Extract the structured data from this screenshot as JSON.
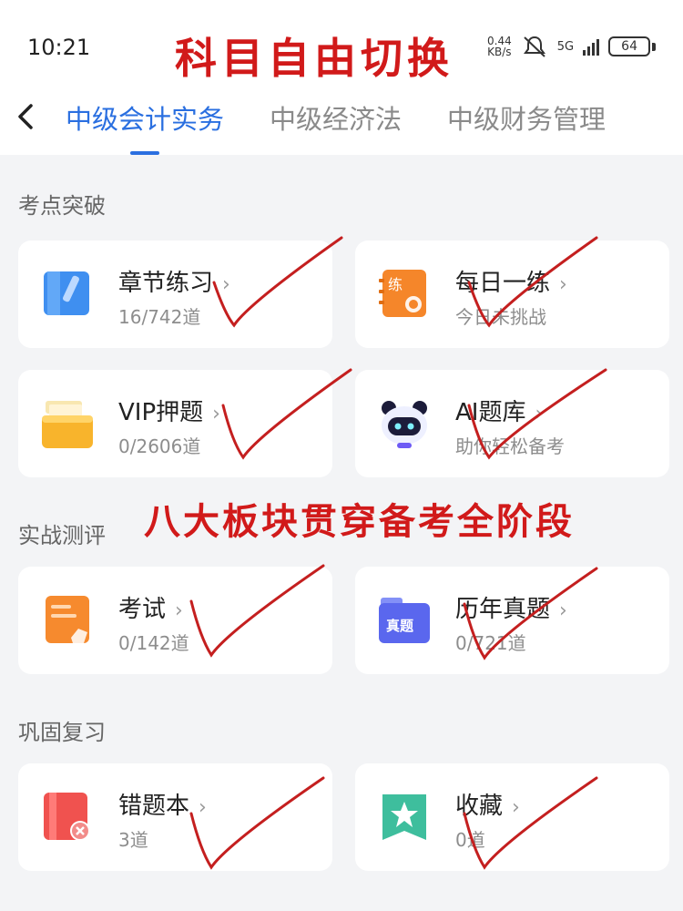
{
  "status": {
    "time": "10:21",
    "net_speed_value": "0.44",
    "net_speed_unit": "KB/s",
    "network": "5G",
    "battery": "64"
  },
  "overlay": {
    "top_title": "科目自由切换",
    "middle_banner": "八大板块贯穿备考全阶段"
  },
  "tabs": [
    {
      "label": "中级会计实务",
      "active": true
    },
    {
      "label": "中级经济法",
      "active": false
    },
    {
      "label": "中级财务管理",
      "active": false
    }
  ],
  "sections": [
    {
      "title": "考点突破",
      "cards": [
        {
          "title": "章节练习",
          "subtitle": "16/742道",
          "icon": "book-icon"
        },
        {
          "title": "每日一练",
          "subtitle": "今日未挑战",
          "icon": "calendar-practice-icon"
        },
        {
          "title": "VIP押题",
          "subtitle": "0/2606道",
          "icon": "folder-icon"
        },
        {
          "title": "AI题库",
          "subtitle": "助你轻松备考",
          "icon": "panda-robot-icon"
        }
      ]
    },
    {
      "title": "实战测评",
      "cards": [
        {
          "title": "考试",
          "subtitle": "0/142道",
          "icon": "exam-paper-icon"
        },
        {
          "title": "历年真题",
          "subtitle": "0/721道",
          "icon": "real-exam-folder-icon"
        }
      ]
    },
    {
      "title": "巩固复习",
      "cards": [
        {
          "title": "错题本",
          "subtitle": "3道",
          "icon": "wrong-notebook-icon"
        },
        {
          "title": "收藏",
          "subtitle": "0道",
          "icon": "star-bookmark-icon"
        }
      ]
    }
  ],
  "labels": {
    "practice_icon_text": "练",
    "real_exam_icon_text": "真题"
  },
  "colors": {
    "accent": "#2a6fe0",
    "overlay_red": "#d11a1a",
    "background": "#f3f4f6"
  }
}
